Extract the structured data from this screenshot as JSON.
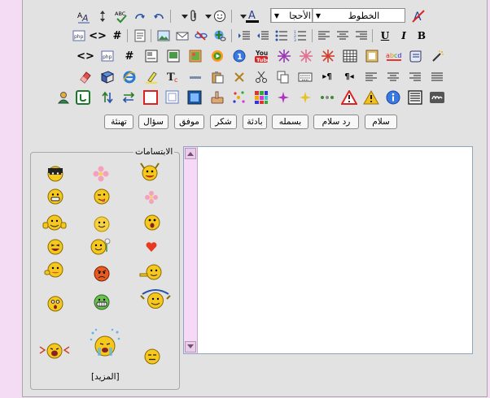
{
  "toolbar": {
    "fonts_label": "الخطوط",
    "sizes_label": "الأحجا",
    "icons": [
      "text-direction-icon",
      "sort-icon",
      "spellcheck-icon",
      "redo-icon",
      "undo-icon",
      "attach-icon",
      "emoticon-icon",
      "font-color-icon"
    ]
  },
  "quick_buttons": [
    "سلام",
    "رد سلام",
    "بسمله",
    "بادئة",
    "شكر",
    "موفق",
    "سؤال",
    "تهنئة"
  ],
  "smilies": {
    "legend": "الابتسامات",
    "more_label": "[المزيد]"
  },
  "colors": {
    "page_bg": "#f5dcf5",
    "panel_bg": "#e2e2e2",
    "editor_border": "#8fa4bf",
    "smiley_yellow": "#f6c81e"
  }
}
